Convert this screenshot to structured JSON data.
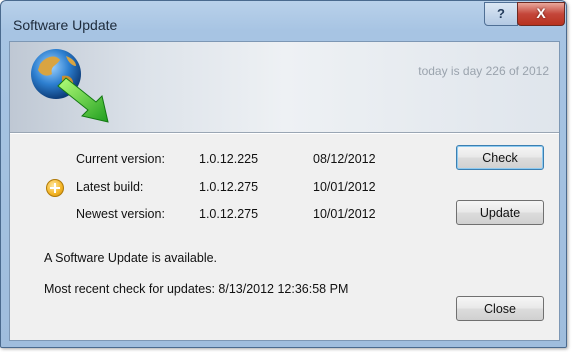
{
  "window": {
    "title": "Software Update"
  },
  "titlebar": {
    "help_label": "?",
    "close_label": "X"
  },
  "banner": {
    "day_text": "today is day 226 of 2012",
    "icon": "globe-download-icon"
  },
  "versions": {
    "current": {
      "label": "Current version:",
      "version": "1.0.12.225",
      "date": "08/12/2012"
    },
    "latest": {
      "label": "Latest build:",
      "version": "1.0.12.275",
      "date": "10/01/2012",
      "icon": "plus-icon"
    },
    "newest": {
      "label": "Newest version:",
      "version": "1.0.12.275",
      "date": "10/01/2012"
    }
  },
  "buttons": {
    "check": "Check",
    "update": "Update",
    "close": "Close"
  },
  "status": {
    "message": "A Software Update is available.",
    "last_check": "Most recent check for updates: 8/13/2012 12:36:58 PM"
  }
}
